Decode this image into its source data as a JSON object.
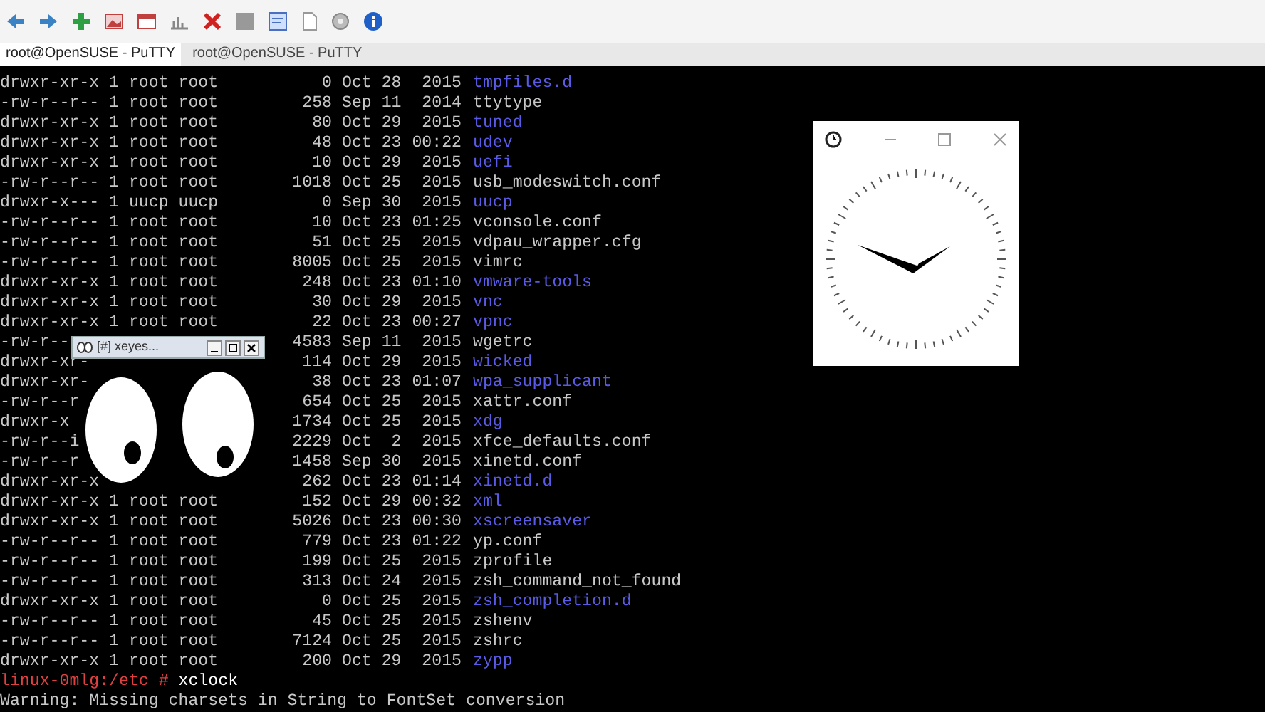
{
  "tabs": [
    {
      "label": "root@OpenSUSE - PuTTY",
      "selected": true
    },
    {
      "label": "root@OpenSUSE - PuTTY",
      "selected": false
    }
  ],
  "terminal": {
    "listing": [
      {
        "left": "drwxr-xr-x 1 root root",
        "size": "0",
        "date": "Oct 28",
        "time": "2015",
        "name": "tmpfiles.d",
        "kind": "dir"
      },
      {
        "left": "-rw-r--r-- 1 root root",
        "size": "258",
        "date": "Sep 11",
        "time": "2014",
        "name": "ttytype",
        "kind": "file"
      },
      {
        "left": "drwxr-xr-x 1 root root",
        "size": "80",
        "date": "Oct 29",
        "time": "2015",
        "name": "tuned",
        "kind": "dir"
      },
      {
        "left": "drwxr-xr-x 1 root root",
        "size": "48",
        "date": "Oct 23",
        "time": "00:22",
        "name": "udev",
        "kind": "dir"
      },
      {
        "left": "drwxr-xr-x 1 root root",
        "size": "10",
        "date": "Oct 29",
        "time": "2015",
        "name": "uefi",
        "kind": "dir"
      },
      {
        "left": "-rw-r--r-- 1 root root",
        "size": "1018",
        "date": "Oct 25",
        "time": "2015",
        "name": "usb_modeswitch.conf",
        "kind": "file"
      },
      {
        "left": "drwxr-x--- 1 uucp uucp",
        "size": "0",
        "date": "Sep 30",
        "time": "2015",
        "name": "uucp",
        "kind": "dir"
      },
      {
        "left": "-rw-r--r-- 1 root root",
        "size": "10",
        "date": "Oct 23",
        "time": "01:25",
        "name": "vconsole.conf",
        "kind": "file"
      },
      {
        "left": "-rw-r--r-- 1 root root",
        "size": "51",
        "date": "Oct 25",
        "time": "2015",
        "name": "vdpau_wrapper.cfg",
        "kind": "file"
      },
      {
        "left": "-rw-r--r-- 1 root root",
        "size": "8005",
        "date": "Oct 25",
        "time": "2015",
        "name": "vimrc",
        "kind": "file"
      },
      {
        "left": "drwxr-xr-x 1 root root",
        "size": "248",
        "date": "Oct 23",
        "time": "01:10",
        "name": "vmware-tools",
        "kind": "dir"
      },
      {
        "left": "drwxr-xr-x 1 root root",
        "size": "30",
        "date": "Oct 29",
        "time": "2015",
        "name": "vnc",
        "kind": "dir"
      },
      {
        "left": "drwxr-xr-x 1 root root",
        "size": "22",
        "date": "Oct 23",
        "time": "00:27",
        "name": "vpnc",
        "kind": "dir"
      },
      {
        "left": "-rw-r--",
        "size": "4583",
        "date": "Sep 11",
        "time": "2015",
        "name": "wgetrc",
        "kind": "file"
      },
      {
        "left": "drwxr-xr-",
        "size": "114",
        "date": "Oct 29",
        "time": "2015",
        "name": "wicked",
        "kind": "dir"
      },
      {
        "left": "drwxr-xr-",
        "size": "38",
        "date": "Oct 23",
        "time": "01:07",
        "name": "wpa_supplicant",
        "kind": "dir"
      },
      {
        "left": "-rw-r--r",
        "size": "654",
        "date": "Oct 25",
        "time": "2015",
        "name": "xattr.conf",
        "kind": "file"
      },
      {
        "left": "drwxr-x",
        "size": "1734",
        "date": "Oct 25",
        "time": "2015",
        "name": "xdg",
        "kind": "dir"
      },
      {
        "left": "-rw-r--i",
        "size": "2229",
        "date": "Oct  2",
        "time": "2015",
        "name": "xfce_defaults.conf",
        "kind": "file"
      },
      {
        "left": "-rw-r--r",
        "size": "1458",
        "date": "Sep 30",
        "time": "2015",
        "name": "xinetd.conf",
        "kind": "file"
      },
      {
        "left": "drwxr-xr-x",
        "size": "262",
        "date": "Oct 23",
        "time": "01:14",
        "name": "xinetd.d",
        "kind": "dir"
      },
      {
        "left": "drwxr-xr-x 1 root root",
        "size": "152",
        "date": "Oct 29",
        "time": "00:32",
        "name": "xml",
        "kind": "dir"
      },
      {
        "left": "drwxr-xr-x 1 root root",
        "size": "5026",
        "date": "Oct 23",
        "time": "00:30",
        "name": "xscreensaver",
        "kind": "dir"
      },
      {
        "left": "-rw-r--r-- 1 root root",
        "size": "779",
        "date": "Oct 23",
        "time": "01:22",
        "name": "yp.conf",
        "kind": "file"
      },
      {
        "left": "-rw-r--r-- 1 root root",
        "size": "199",
        "date": "Oct 25",
        "time": "2015",
        "name": "zprofile",
        "kind": "file"
      },
      {
        "left": "-rw-r--r-- 1 root root",
        "size": "313",
        "date": "Oct 24",
        "time": "2015",
        "name": "zsh_command_not_found",
        "kind": "file"
      },
      {
        "left": "drwxr-xr-x 1 root root",
        "size": "0",
        "date": "Oct 25",
        "time": "2015",
        "name": "zsh_completion.d",
        "kind": "dir"
      },
      {
        "left": "-rw-r--r-- 1 root root",
        "size": "45",
        "date": "Oct 25",
        "time": "2015",
        "name": "zshenv",
        "kind": "file"
      },
      {
        "left": "-rw-r--r-- 1 root root",
        "size": "7124",
        "date": "Oct 25",
        "time": "2015",
        "name": "zshrc",
        "kind": "file"
      },
      {
        "left": "drwxr-xr-x 1 root root",
        "size": "200",
        "date": "Oct 29",
        "time": "2015",
        "name": "zypp",
        "kind": "dir"
      }
    ],
    "prompt": {
      "host": "linux-0mlg:/etc #",
      "command": "xclock"
    },
    "warning": "Warning: Missing charsets in String to FontSet conversion"
  },
  "xeyes_window": {
    "title": "[#] xeyes..."
  }
}
